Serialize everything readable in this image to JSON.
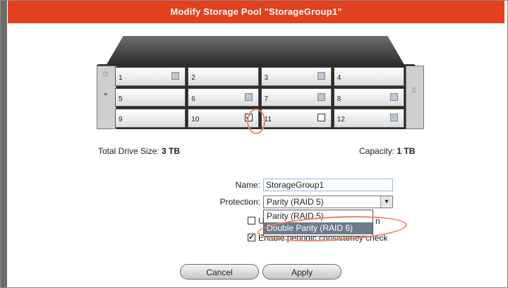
{
  "dialog": {
    "title": "Modify Storage Pool \"StorageGroup1\""
  },
  "enclosure": {
    "bays": [
      {
        "number": "1",
        "checkbox": "checked-disabled"
      },
      {
        "number": "2",
        "checkbox": "none"
      },
      {
        "number": "3",
        "checkbox": "checked-disabled"
      },
      {
        "number": "4",
        "checkbox": "none"
      },
      {
        "number": "5",
        "checkbox": "none"
      },
      {
        "number": "6",
        "checkbox": "checked-disabled"
      },
      {
        "number": "7",
        "checkbox": "checked-disabled"
      },
      {
        "number": "8",
        "checkbox": "checked-disabled"
      },
      {
        "number": "9",
        "checkbox": "none"
      },
      {
        "number": "10",
        "checkbox": "checked"
      },
      {
        "number": "11",
        "checkbox": "unchecked"
      },
      {
        "number": "12",
        "checkbox": "checked-disabled"
      }
    ]
  },
  "summary": {
    "total_label": "Total Drive Size:",
    "total_value": "3 TB",
    "capacity_label": "Capacity:",
    "capacity_value": "1 TB"
  },
  "form": {
    "name_label": "Name:",
    "name_value": "StorageGroup1",
    "protection_label": "Protection:",
    "protection_value": "Parity (RAID 5)",
    "protection_options": [
      "Parity (RAID 5)",
      "Double Parity (RAID 6)"
    ],
    "option1_fragment_left": "U",
    "option1_fragment_right": "n",
    "option2_label": "Enable periodic consistency check",
    "option2_checked": true
  },
  "buttons": {
    "cancel": "Cancel",
    "apply": "Apply"
  },
  "colors": {
    "title_bar": "#e2401f",
    "highlight": "#ef7f63",
    "selected_option": "#6e7b8c"
  }
}
